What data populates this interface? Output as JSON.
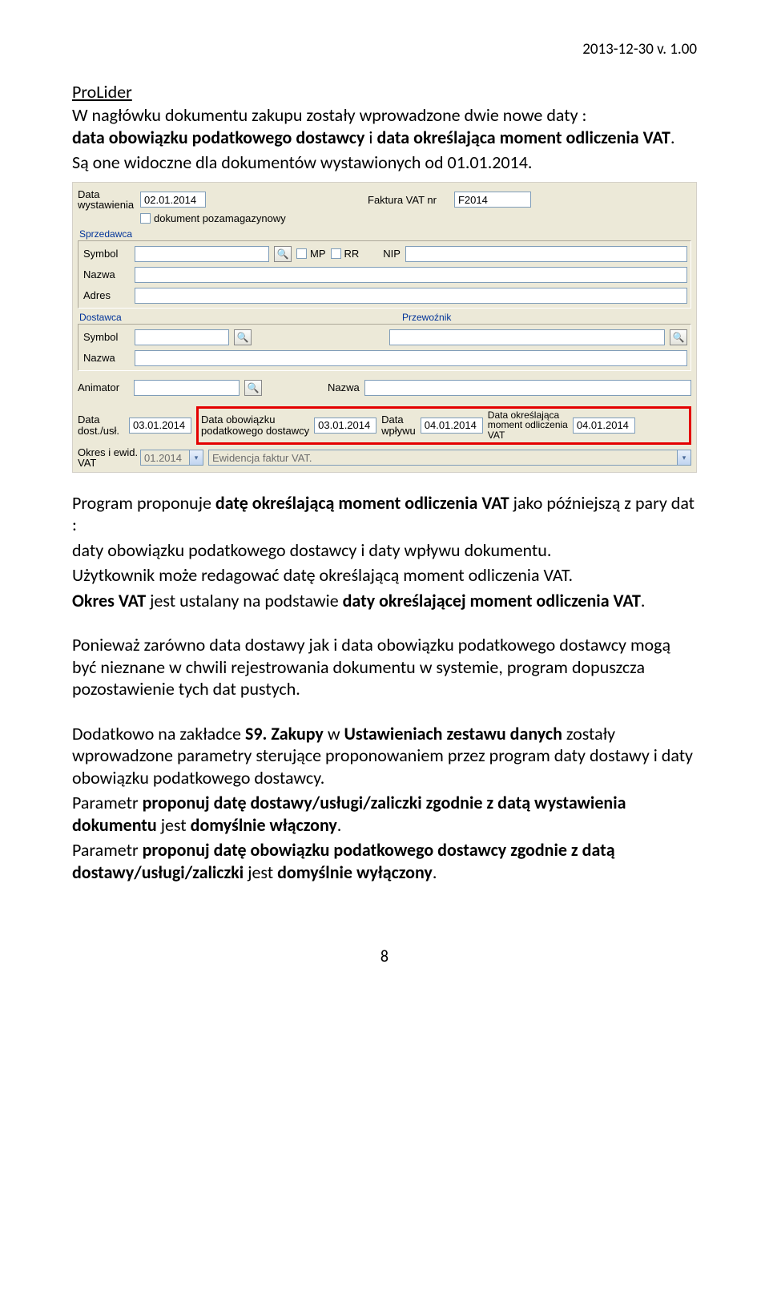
{
  "header": {
    "version_date": "2013-12-30 v. 1.00"
  },
  "title": "ProLider",
  "intro": {
    "p1a": "W nagłówku dokumentu zakupu zostały wprowadzone dwie nowe daty :",
    "p1b_bold": "data obowiązku podatkowego dostawcy",
    "p1b_conj": " i ",
    "p1c_bold": "data określająca moment odliczenia VAT",
    "p1c_end": ".",
    "p2": "Są one widoczne dla dokumentów wystawionych od 01.01.2014."
  },
  "form": {
    "labels": {
      "data_wyst": "Data\nwystawienia",
      "doc_poza": "dokument pozamagazynowy",
      "faktura_vat_nr": "Faktura VAT nr",
      "sprzedawca": "Sprzedawca",
      "symbol": "Symbol",
      "mp": "MP",
      "rr": "RR",
      "nip": "NIP",
      "nazwa": "Nazwa",
      "adres": "Adres",
      "dostawca": "Dostawca",
      "przewoznik": "Przewoźnik",
      "animator": "Animator",
      "nazwa2": "Nazwa",
      "data_dost": "Data\ndost./usł.",
      "data_obow": "Data obowiązku\npodatkowego dostawcy",
      "data_wplywu": "Data\nwpływu",
      "data_okresl": "Data określająca\nmoment odliczenia\nVAT",
      "okres": "Okres i ewid.\nVAT",
      "ewid": "Ewidencja faktur VAT."
    },
    "values": {
      "data_wyst": "02.01.2014",
      "faktura_nr": "F2014",
      "data_dost": "03.01.2014",
      "data_obow": "03.01.2014",
      "data_wplywu": "04.01.2014",
      "data_okresl": "04.01.2014",
      "okres": "01.2014"
    }
  },
  "para2": {
    "l1a": "Program proponuje  ",
    "l1b_bold": "datę określającą moment odliczenia VAT",
    "l1c": " jako późniejszą z pary dat :",
    "l2": "daty obowiązku podatkowego dostawcy i daty wpływu dokumentu.",
    "l3": "Użytkownik może redagować datę określającą moment odliczenia VAT.",
    "l4a_bold": "Okres VAT",
    "l4b": " jest ustalany na podstawie ",
    "l4c_bold": "daty określającej moment odliczenia VAT",
    "l4d": "."
  },
  "para3": "Ponieważ zarówno data dostawy jak i data obowiązku podatkowego dostawcy mogą być nieznane w chwili rejestrowania dokumentu w systemie, program dopuszcza pozostawienie tych dat pustych.",
  "para4": {
    "l1a": "Dodatkowo na zakładce ",
    "l1b_bold": "S9. Zakupy",
    "l1c": " w ",
    "l1d_bold": "Ustawieniach zestawu danych",
    "l1e": " zostały wprowadzone parametry sterujące proponowaniem przez program daty dostawy i daty obowiązku podatkowego dostawcy."
  },
  "para5": {
    "a": "Parametr ",
    "b_bold": "proponuj datę dostawy/usługi/zaliczki zgodnie z datą wystawienia dokumentu",
    "c": " jest ",
    "d_bold": "domyślnie włączony",
    "e": "."
  },
  "para6": {
    "a": "Parametr ",
    "b_bold": "proponuj datę obowiązku podatkowego dostawcy zgodnie z datą dostawy/usługi/zaliczki",
    "c": " jest ",
    "d_bold": "domyślnie wyłączony",
    "e": "."
  },
  "page_number": "8"
}
